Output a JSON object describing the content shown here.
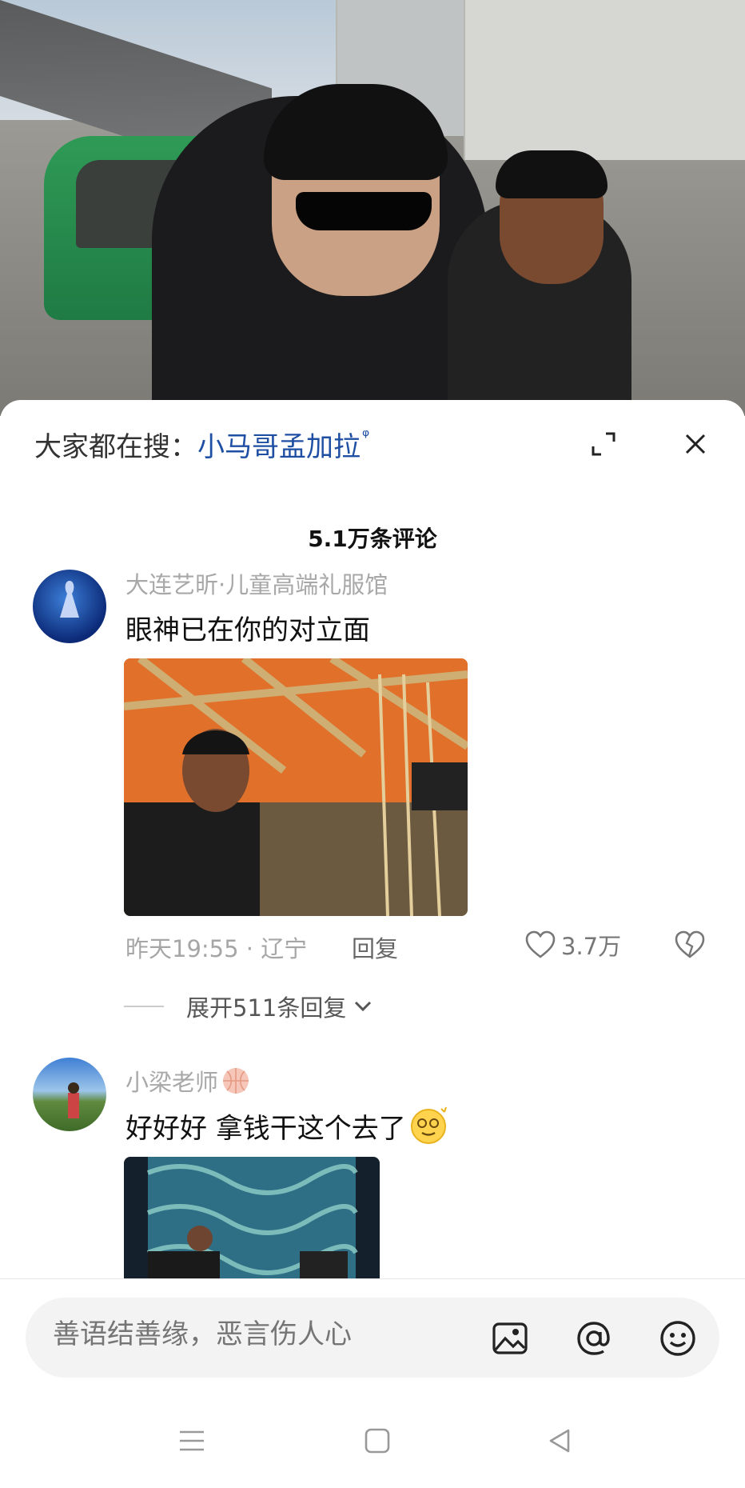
{
  "search_hint": {
    "label": "大家都在搜：",
    "term": "小马哥孟加拉",
    "magnifier": "ᵠ"
  },
  "comments_header": {
    "count_label": "5.1万条评论"
  },
  "comments": [
    {
      "username": "大连艺昕·儿童高端礼服馆",
      "text": "眼神已在你的对立面",
      "time_location": "昨天19:55 · 辽宁",
      "reply_label": "回复",
      "likes": "3.7万",
      "expand_replies": "展开511条回复"
    },
    {
      "username": "小梁老师",
      "text": "好好好 拿钱干这个去了"
    }
  ],
  "composer": {
    "placeholder": "善语结善缘，恶言伤人心"
  },
  "colors": {
    "accent": "#1f4fa3",
    "muted": "#a6a6a6"
  }
}
